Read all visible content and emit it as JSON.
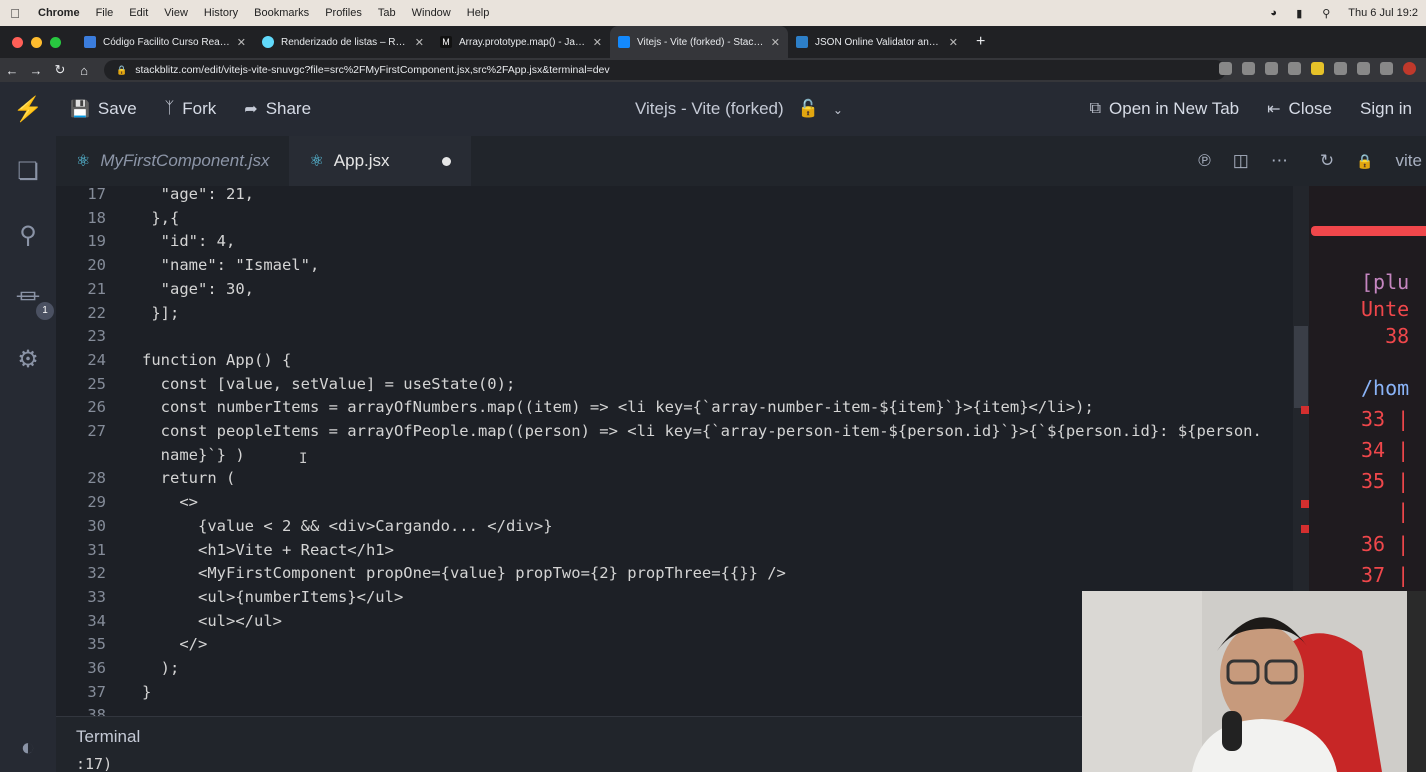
{
  "menubar": {
    "app": "Chrome",
    "items": [
      "File",
      "Edit",
      "View",
      "History",
      "Bookmarks",
      "Profiles",
      "Tab",
      "Window",
      "Help"
    ],
    "clock": "Thu 6 Jul  19:2"
  },
  "browser": {
    "tabs": [
      {
        "label": "Código Facilito Curso React Js",
        "color": "#3b7ddd"
      },
      {
        "label": "Renderizado de listas – React",
        "color": "#61dafb"
      },
      {
        "label": "Array.prototype.map() - JavaSc",
        "color": "#222222"
      },
      {
        "label": "Vitejs - Vite (forked) - StackBli",
        "color": "#1389fd"
      },
      {
        "label": "JSON Online Validator and For",
        "color": "#2d7fc8"
      }
    ],
    "active_tab": 3,
    "url": "stackblitz.com/edit/vitejs-vite-snuvgc?file=src%2FMyFirstComponent.jsx,src%2FApp.jsx&terminal=dev"
  },
  "stackblitz": {
    "save": "Save",
    "fork": "Fork",
    "share": "Share",
    "project_title": "Vitejs - Vite (forked)",
    "open_new_tab": "Open in New Tab",
    "close": "Close",
    "sign_in": "Sign in",
    "extensions_badge": "1"
  },
  "editor": {
    "tabs": [
      {
        "label": "MyFirstComponent.jsx"
      },
      {
        "label": "App.jsx"
      }
    ],
    "right_label": "vite"
  },
  "code_lines": [
    {
      "n": "17",
      "t": "  \"age\": 21,"
    },
    {
      "n": "18",
      "t": " },{"
    },
    {
      "n": "19",
      "t": "  \"id\": 4,"
    },
    {
      "n": "20",
      "t": "  \"name\": \"Ismael\","
    },
    {
      "n": "21",
      "t": "  \"age\": 30,"
    },
    {
      "n": "22",
      "t": " }];"
    },
    {
      "n": "23",
      "t": ""
    },
    {
      "n": "24",
      "t": "function App() {"
    },
    {
      "n": "25",
      "t": "  const [value, setValue] = useState(0);"
    },
    {
      "n": "26",
      "t": "  const numberItems = arrayOfNumbers.map((item) => <li key={`array-number-item-${item}`}>{item}</li>);"
    },
    {
      "n": "27",
      "t": "  const peopleItems = arrayOfPeople.map((person) => <li key={`array-person-item-${person.id}`}>{`${person.id}: ${person."
    },
    {
      "n": "",
      "t": "  name}`} )"
    },
    {
      "n": "28",
      "t": "  return ("
    },
    {
      "n": "29",
      "t": "    <>"
    },
    {
      "n": "30",
      "t": "      {value < 2 && <div>Cargando... </div>}"
    },
    {
      "n": "31",
      "t": "      <h1>Vite + React</h1>"
    },
    {
      "n": "32",
      "t": "      <MyFirstComponent propOne={value} propTwo={2} propThree={{}} />"
    },
    {
      "n": "33",
      "t": "      <ul>{numberItems}</ul>"
    },
    {
      "n": "34",
      "t": "      <ul></ul>"
    },
    {
      "n": "35",
      "t": "    </>"
    },
    {
      "n": "36",
      "t": "  );"
    },
    {
      "n": "37",
      "t": "}"
    },
    {
      "n": "38",
      "t": ""
    }
  ],
  "preview": {
    "lines": [
      "[plu",
      "Unte",
      "  38",
      "",
      "/hom",
      "33 |",
      "34 |",
      "35 |",
      "   |",
      "36 |",
      "37 |"
    ]
  },
  "terminal": {
    "title": "Terminal",
    "line": ":17)"
  },
  "colors": {
    "accent": "#1389fd",
    "error": "#f0474b"
  }
}
